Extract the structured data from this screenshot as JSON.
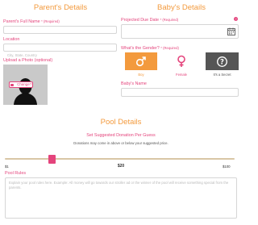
{
  "parents_section": {
    "title": "Parent's Details",
    "full_name": {
      "label": "Parent's Full Name",
      "required": "* (Required)",
      "value": ""
    },
    "location": {
      "label": "Location",
      "placeholder": "City, State, Country"
    },
    "photo": {
      "label": "Upload a Photo (optional)",
      "change_button": "Change?"
    }
  },
  "baby_section": {
    "title": "Baby's Details",
    "due_date": {
      "label": "Projected Due Date",
      "required": "* (Required)"
    },
    "gender": {
      "label": "What's the Gender?",
      "required": "* (Required)",
      "options": [
        {
          "caption": "Boy",
          "icon": "male-symbol-icon",
          "color": "#f39a3d"
        },
        {
          "caption": "Female",
          "icon": "female-symbol-icon",
          "color": "#e4447c"
        },
        {
          "caption": "It's a Secret",
          "icon": "question-mark-icon",
          "color": "#555555"
        }
      ]
    },
    "baby_name": {
      "label": "Baby's Name",
      "value": ""
    }
  },
  "pool_section": {
    "title": "Pool Details",
    "donation_heading": "Set Suggested Donation Per Guess",
    "donation_note": "Donations may come in above or below your suggested price.",
    "slider": {
      "min_label": "$1",
      "value_label": "$20",
      "max_label": "$100",
      "min": 1,
      "max": 100,
      "value": 20
    },
    "rules": {
      "label": "Pool Rules",
      "placeholder": "Explain your pool rules here. Example: All money will go towards our stroller ad or the winner of the pool will receive something special from the parents."
    }
  },
  "colors": {
    "accent": "#f39a3d",
    "brand_pink": "#e4447c",
    "dark_gray": "#555555"
  }
}
